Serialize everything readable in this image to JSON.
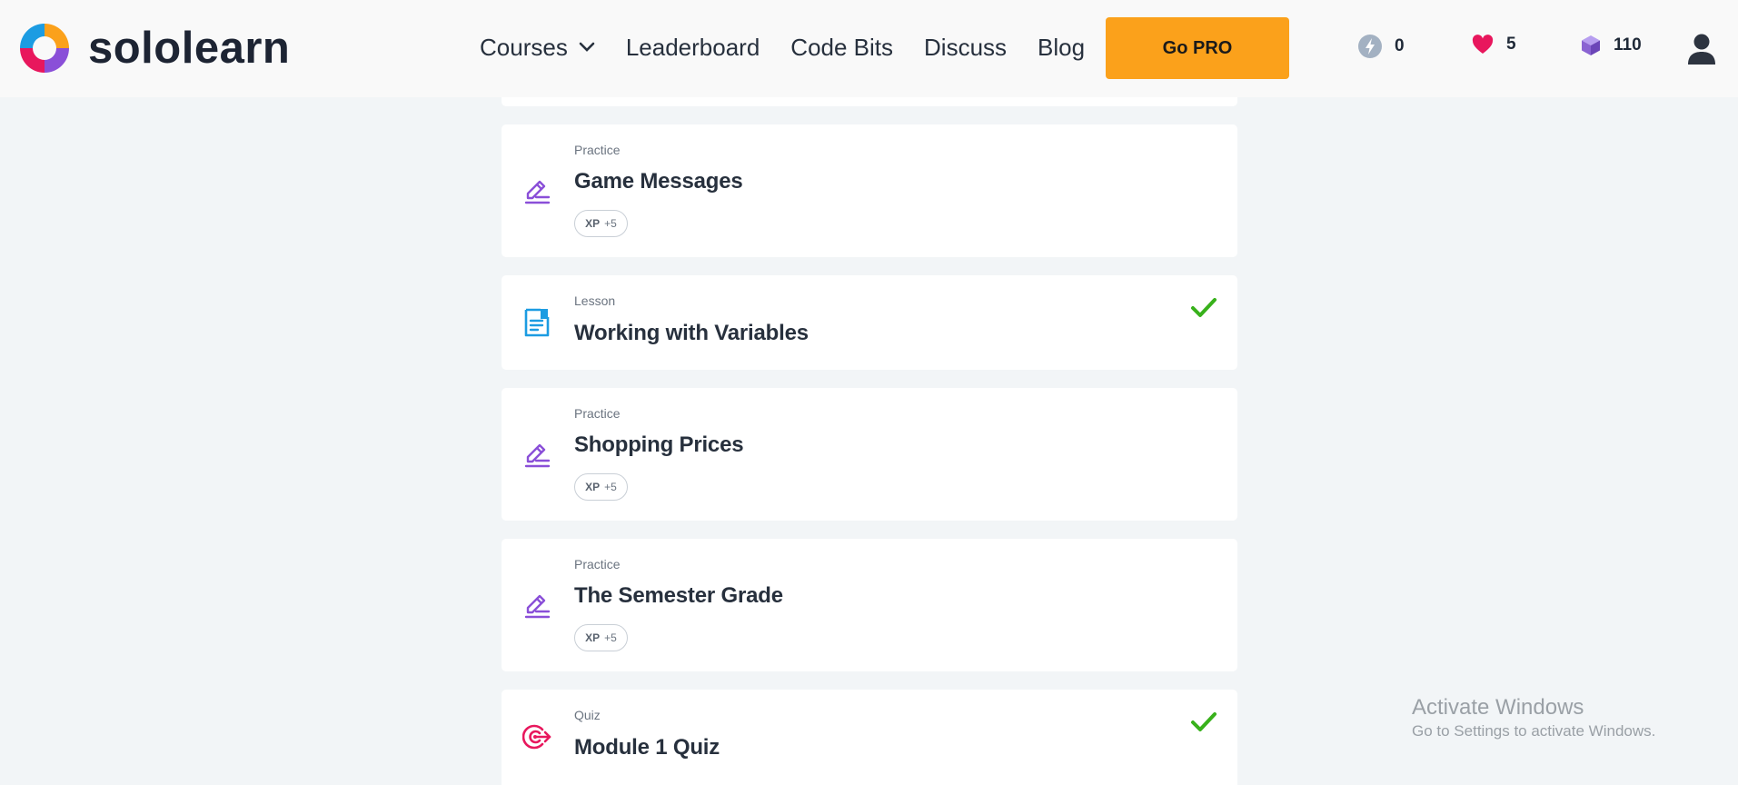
{
  "brand": {
    "name": "sololearn"
  },
  "nav": {
    "items": [
      {
        "label": "Courses",
        "has_dropdown": true
      },
      {
        "label": "Leaderboard"
      },
      {
        "label": "Code Bits"
      },
      {
        "label": "Discuss"
      },
      {
        "label": "Blog"
      }
    ],
    "go_pro_label": "Go PRO"
  },
  "stats": {
    "bolt": {
      "value": "0",
      "icon": "bolt-icon",
      "color": "#a3b1c2"
    },
    "hearts": {
      "value": "5",
      "icon": "heart-icon",
      "color": "#e8175d"
    },
    "gems": {
      "value": "110",
      "icon": "gem-icon",
      "color": "#8a63d2"
    }
  },
  "lessons": [
    {
      "type": "Practice",
      "title": "Game Messages",
      "xp_label": "XP",
      "xp_value": "+5",
      "completed": false,
      "icon": "pencil-icon"
    },
    {
      "type": "Lesson",
      "title": "Working with Variables",
      "completed": true,
      "icon": "lesson-icon"
    },
    {
      "type": "Practice",
      "title": "Shopping Prices",
      "xp_label": "XP",
      "xp_value": "+5",
      "completed": false,
      "icon": "pencil-icon"
    },
    {
      "type": "Practice",
      "title": "The Semester Grade",
      "xp_label": "XP",
      "xp_value": "+5",
      "completed": false,
      "icon": "pencil-icon"
    },
    {
      "type": "Quiz",
      "title": "Module 1 Quiz",
      "completed": true,
      "icon": "target-icon"
    }
  ],
  "colors": {
    "accent_pro": "#fba11b",
    "practice_icon": "#8a4fd8",
    "lesson_icon": "#1c9ce2",
    "quiz_icon": "#e8175d",
    "check": "#38b11b"
  },
  "watermark": {
    "title": "Activate Windows",
    "subtitle": "Go to Settings to activate Windows."
  }
}
